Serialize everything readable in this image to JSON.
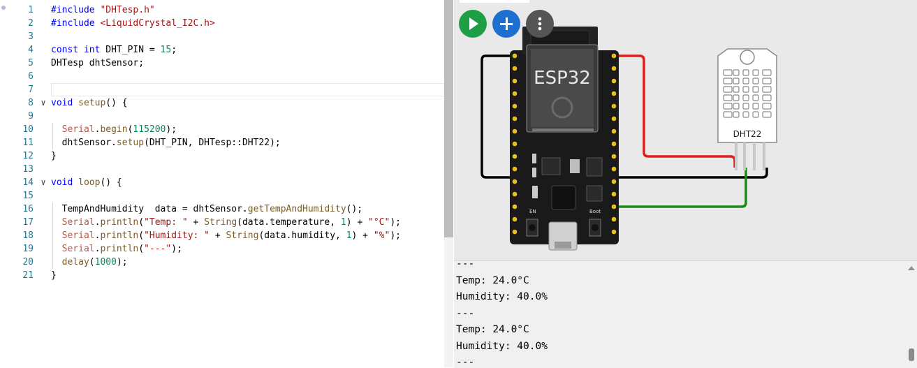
{
  "editor": {
    "lines": [
      {
        "n": "1",
        "parts": [
          [
            "pp",
            "#include "
          ],
          [
            "str",
            "\"DHTesp.h\""
          ]
        ]
      },
      {
        "n": "2",
        "parts": [
          [
            "pp",
            "#include "
          ],
          [
            "str",
            "<LiquidCrystal_I2C.h>"
          ]
        ]
      },
      {
        "n": "3",
        "parts": []
      },
      {
        "n": "4",
        "parts": [
          [
            "kw",
            "const int"
          ],
          [
            "t",
            " DHT_PIN = "
          ],
          [
            "num",
            "15"
          ],
          [
            "t",
            ";"
          ]
        ]
      },
      {
        "n": "5",
        "parts": [
          [
            "t",
            "DHTesp dhtSensor;"
          ]
        ]
      },
      {
        "n": "6",
        "parts": []
      },
      {
        "n": "7",
        "parts": []
      },
      {
        "n": "8",
        "fold": true,
        "parts": [
          [
            "kw",
            "void"
          ],
          [
            "t",
            " "
          ],
          [
            "fn",
            "setup"
          ],
          [
            "t",
            "() {"
          ]
        ]
      },
      {
        "n": "9",
        "parts": []
      },
      {
        "n": "10",
        "parts": [
          [
            "t",
            "  "
          ],
          [
            "obj",
            "Serial"
          ],
          [
            "t",
            "."
          ],
          [
            "fn",
            "begin"
          ],
          [
            "t",
            "("
          ],
          [
            "num",
            "115200"
          ],
          [
            "t",
            ");"
          ]
        ]
      },
      {
        "n": "11",
        "parts": [
          [
            "t",
            "  dhtSensor."
          ],
          [
            "fn",
            "setup"
          ],
          [
            "t",
            "(DHT_PIN, DHTesp::DHT22);"
          ]
        ]
      },
      {
        "n": "12",
        "parts": [
          [
            "t",
            "}"
          ]
        ]
      },
      {
        "n": "13",
        "parts": []
      },
      {
        "n": "14",
        "fold": true,
        "parts": [
          [
            "kw",
            "void"
          ],
          [
            "t",
            " "
          ],
          [
            "fn",
            "loop"
          ],
          [
            "t",
            "() {"
          ]
        ]
      },
      {
        "n": "15",
        "parts": []
      },
      {
        "n": "16",
        "parts": [
          [
            "t",
            "  TempAndHumidity  data = dhtSensor."
          ],
          [
            "fn",
            "getTempAndHumidity"
          ],
          [
            "t",
            "();"
          ]
        ]
      },
      {
        "n": "17",
        "parts": [
          [
            "t",
            "  "
          ],
          [
            "obj",
            "Serial"
          ],
          [
            "t",
            "."
          ],
          [
            "fn",
            "println"
          ],
          [
            "t",
            "("
          ],
          [
            "str",
            "\"Temp: \""
          ],
          [
            "t",
            " + "
          ],
          [
            "fn",
            "String"
          ],
          [
            "t",
            "(data.temperature, "
          ],
          [
            "num",
            "1"
          ],
          [
            "t",
            ") + "
          ],
          [
            "str",
            "\"°C\""
          ],
          [
            "t",
            ");"
          ]
        ]
      },
      {
        "n": "18",
        "parts": [
          [
            "t",
            "  "
          ],
          [
            "obj",
            "Serial"
          ],
          [
            "t",
            "."
          ],
          [
            "fn",
            "println"
          ],
          [
            "t",
            "("
          ],
          [
            "str",
            "\"Humidity: \""
          ],
          [
            "t",
            " + "
          ],
          [
            "fn",
            "String"
          ],
          [
            "t",
            "(data.humidity, "
          ],
          [
            "num",
            "1"
          ],
          [
            "t",
            ") + "
          ],
          [
            "str",
            "\"%\""
          ],
          [
            "t",
            ");"
          ]
        ]
      },
      {
        "n": "19",
        "parts": [
          [
            "t",
            "  "
          ],
          [
            "obj",
            "Serial"
          ],
          [
            "t",
            "."
          ],
          [
            "fn",
            "println"
          ],
          [
            "t",
            "("
          ],
          [
            "str",
            "\"---\""
          ],
          [
            "t",
            ");"
          ]
        ]
      },
      {
        "n": "20",
        "parts": [
          [
            "t",
            "  "
          ],
          [
            "fn",
            "delay"
          ],
          [
            "t",
            "("
          ],
          [
            "num",
            "1000"
          ],
          [
            "t",
            ");"
          ]
        ]
      },
      {
        "n": "21",
        "parts": [
          [
            "t",
            "}"
          ]
        ]
      }
    ]
  },
  "simulator": {
    "buttons": [
      {
        "name": "start-simulation-button",
        "icon": "play-icon",
        "color": "#1e9e45"
      },
      {
        "name": "add-part-button",
        "icon": "plus-icon",
        "color": "#1f6fd1"
      },
      {
        "name": "more-options-button",
        "icon": "kebab-menu-icon",
        "color": "#555555"
      }
    ],
    "esp32": {
      "label": "ESP32",
      "en_label": "EN",
      "boot_label": "Boot"
    },
    "dht22": {
      "label": "DHT22"
    },
    "wire_colors": {
      "power": "#000000",
      "vcc": "#e31c1c",
      "data": "#1a8a1a"
    }
  },
  "serial_monitor": {
    "lines": [
      "---",
      "Temp: 24.0°C",
      "Humidity: 40.0%",
      "---",
      "Temp: 24.0°C",
      "Humidity: 40.0%",
      "---"
    ]
  }
}
